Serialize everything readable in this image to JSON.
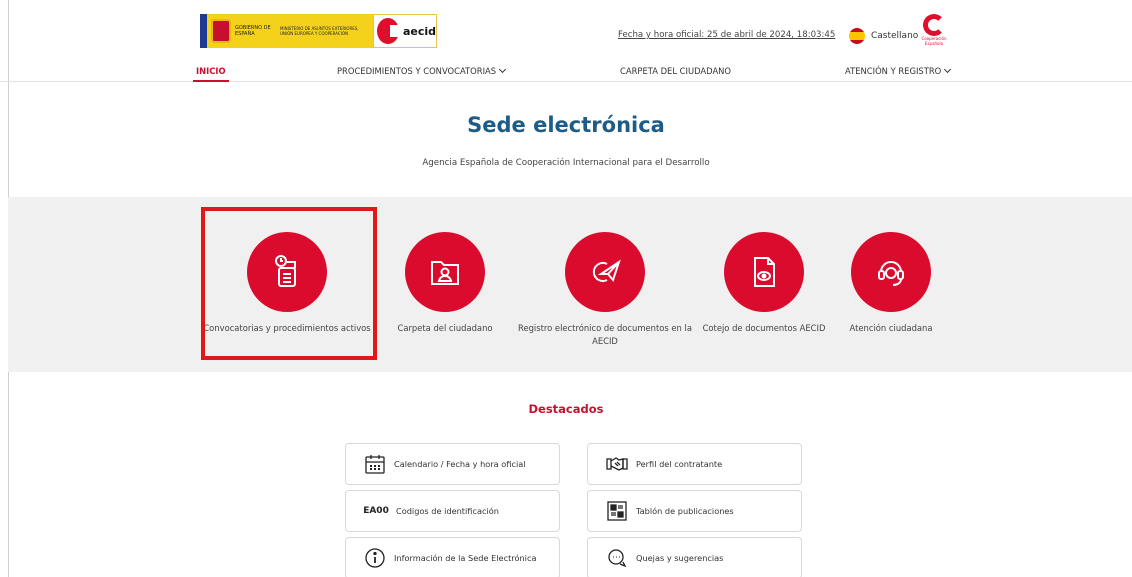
{
  "header": {
    "gov_text": "GOBIERNO DE ESPAÑA",
    "ministry_text": "MINISTERIO DE ASUNTOS EXTERIORES, UNIÓN EUROPEA Y COOPERACIÓN",
    "aecid_text": "aecid",
    "datetime": "Fecha y hora oficial: 25 de abril de 2024, 18:03:45",
    "language": "Castellano",
    "coop_text": "Cooperación Española"
  },
  "nav": {
    "inicio": "INICIO",
    "procedimientos": "PROCEDIMIENTOS Y CONVOCATORIAS",
    "carpeta": "CARPETA DEL CIUDADANO",
    "atencion": "ATENCIÓN Y REGISTRO"
  },
  "hero": {
    "title": "Sede electrónica",
    "subtitle": "Agencia Española de Cooperación Internacional para el Desarrollo"
  },
  "tiles": [
    {
      "label": "Convocatorias y procedimientos activos",
      "icon": "document-clock-icon"
    },
    {
      "label": "Carpeta del ciudadano",
      "icon": "folder-user-icon"
    },
    {
      "label": "Registro electrónico de documentos en la AECID",
      "icon": "paper-plane-icon"
    },
    {
      "label": "Cotejo de documentos AECID",
      "icon": "document-eye-icon"
    },
    {
      "label": "Atención ciudadana",
      "icon": "headset-icon"
    }
  ],
  "destacados": {
    "title": "Destacados",
    "cards": [
      {
        "label": "Calendario / Fecha y hora oficial",
        "icon": "calendar-icon"
      },
      {
        "label": "Perfil del contratante",
        "icon": "handshake-icon"
      },
      {
        "label": "Codigos de identificación",
        "icon_text": "EA00"
      },
      {
        "label": "Tablón de publicaciones",
        "icon": "bulletin-board-icon"
      },
      {
        "label": "Información de la Sede Electrónica",
        "icon": "info-icon"
      },
      {
        "label": "Quejas y sugerencias",
        "icon": "chat-icon"
      }
    ]
  },
  "colors": {
    "brand_red": "#da0b2c",
    "title_blue": "#1c5c87",
    "highlight_red": "#e11818"
  }
}
